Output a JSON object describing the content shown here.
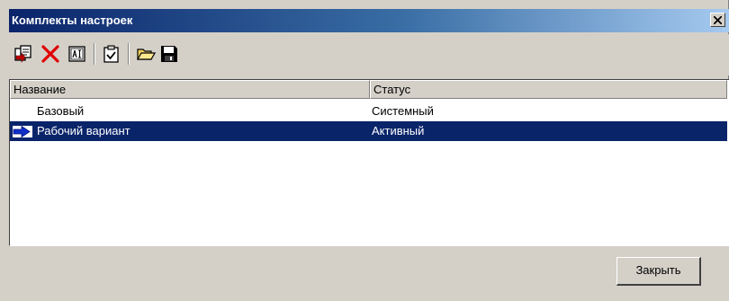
{
  "window": {
    "title": "Комплекты настроек",
    "close_glyph": "✕"
  },
  "toolbar": {
    "buttons": [
      {
        "icon": "copy-set-icon"
      },
      {
        "icon": "delete-icon",
        "color": "#e00000"
      },
      {
        "icon": "rename-icon"
      },
      {
        "icon": "activate-icon"
      },
      {
        "icon": "open-folder-icon"
      },
      {
        "icon": "save-icon"
      }
    ]
  },
  "table": {
    "columns": [
      "Название",
      "Статус"
    ],
    "rows": [
      {
        "name": "Базовый",
        "status": "Системный",
        "selected": false
      },
      {
        "name": "Рабочий вариант",
        "status": "Активный",
        "selected": true
      }
    ]
  },
  "footer": {
    "close_label": "Закрыть"
  },
  "colors": {
    "title_gradient_start": "#0a246a",
    "title_gradient_end": "#a6caf0",
    "selection": "#0a246a",
    "marker_arrow": "#1030c8"
  }
}
